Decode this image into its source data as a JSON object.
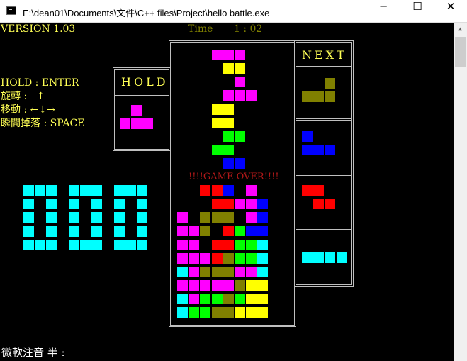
{
  "window": {
    "title": "E:\\dean01\\Documents\\文件\\C++ files\\Project\\hello battle.exe",
    "buttons": {
      "minimize": "─",
      "maximize": "☐",
      "close": "✕"
    }
  },
  "game": {
    "version": "VERSION 1.03",
    "time_label": "Time",
    "time_value": "1 : 02",
    "controls": {
      "hold": "HOLD : ENTER",
      "rotate": "旋轉 :   ↑",
      "move": "移動 : ←↓→",
      "drop": "瞬間掉落 : SPACE"
    },
    "hold_title": "HOLD",
    "next_title": "NEXT",
    "game_over": "!!!!GAME OVER!!!!",
    "ime_status": "微軟注音 半 :",
    "score": "000",
    "colors": {
      "magenta": "#ff00ff",
      "yellow": "#ffff00",
      "green": "#00ff00",
      "blue": "#0000ff",
      "red": "#ff0000",
      "olive": "#808000",
      "cyan": "#00ffff"
    },
    "hold_piece": {
      "color": "magenta",
      "cells": [
        [
          1,
          0
        ],
        [
          0,
          1
        ],
        [
          1,
          1
        ],
        [
          2,
          1
        ]
      ]
    },
    "next_pieces": [
      {
        "color": "olive",
        "cells": [
          [
            2,
            0
          ],
          [
            0,
            1
          ],
          [
            1,
            1
          ],
          [
            2,
            1
          ]
        ]
      },
      {
        "color": "blue",
        "cells": [
          [
            0,
            0
          ],
          [
            0,
            1
          ],
          [
            1,
            1
          ],
          [
            2,
            1
          ]
        ]
      },
      {
        "color": "red",
        "cells": [
          [
            0,
            0
          ],
          [
            1,
            0
          ],
          [
            1,
            1
          ],
          [
            2,
            1
          ]
        ]
      },
      {
        "color": "cyan",
        "cells": [
          [
            0,
            0
          ],
          [
            1,
            0
          ],
          [
            2,
            0
          ],
          [
            3,
            0
          ]
        ]
      }
    ],
    "falling_cells": [
      [
        3,
        0,
        "magenta"
      ],
      [
        4,
        0,
        "magenta"
      ],
      [
        5,
        0,
        "magenta"
      ],
      [
        4,
        1,
        "yellow"
      ],
      [
        5,
        1,
        "yellow"
      ],
      [
        5,
        2,
        "magenta"
      ],
      [
        4,
        3,
        "magenta"
      ],
      [
        5,
        3,
        "magenta"
      ],
      [
        6,
        3,
        "magenta"
      ],
      [
        3,
        4,
        "yellow"
      ],
      [
        4,
        4,
        "yellow"
      ],
      [
        3,
        5,
        "yellow"
      ],
      [
        4,
        5,
        "yellow"
      ],
      [
        4,
        6,
        "green"
      ],
      [
        5,
        6,
        "green"
      ],
      [
        3,
        7,
        "green"
      ],
      [
        4,
        7,
        "green"
      ],
      [
        4,
        8,
        "blue"
      ],
      [
        5,
        8,
        "blue"
      ]
    ],
    "stack_rows": [
      [
        null,
        null,
        "red",
        "red",
        "blue",
        null,
        "magenta",
        null
      ],
      [
        null,
        null,
        null,
        "red",
        "red",
        "magenta",
        "magenta",
        "blue"
      ],
      [
        "magenta",
        null,
        "olive",
        "olive",
        "olive",
        null,
        "magenta",
        "blue"
      ],
      [
        "magenta",
        "magenta",
        "olive",
        null,
        "red",
        "green",
        "blue",
        "blue"
      ],
      [
        "magenta",
        "magenta",
        null,
        "red",
        "red",
        "green",
        "green",
        "cyan"
      ],
      [
        "magenta",
        "magenta",
        "magenta",
        "red",
        "olive",
        "green",
        "green",
        "cyan"
      ],
      [
        "cyan",
        "magenta",
        "olive",
        "olive",
        "olive",
        "magenta",
        "magenta",
        "cyan"
      ],
      [
        "magenta",
        "magenta",
        "magenta",
        "magenta",
        "magenta",
        "olive",
        "yellow",
        "yellow"
      ],
      [
        "cyan",
        "magenta",
        "green",
        "green",
        "olive",
        "green",
        "yellow",
        "yellow"
      ],
      [
        "cyan",
        "green",
        "green",
        "olive",
        "olive",
        "yellow",
        "yellow",
        "yellow"
      ]
    ]
  }
}
